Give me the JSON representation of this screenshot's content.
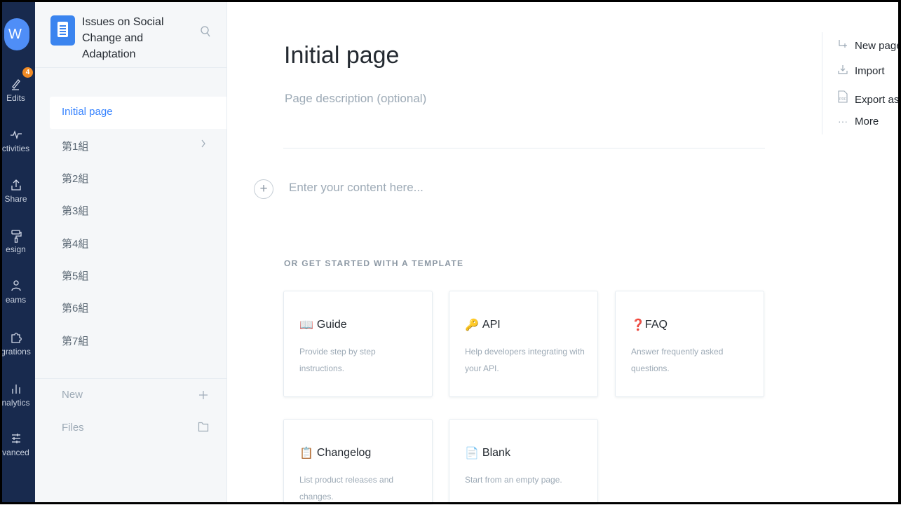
{
  "rail": {
    "avatar": "W",
    "badge": "4",
    "items": [
      {
        "icon": "edit-icon",
        "label": "Edits"
      },
      {
        "icon": "activity-icon",
        "label": "ctivities"
      },
      {
        "icon": "share-icon",
        "label": "Share"
      },
      {
        "icon": "paint-roller-icon",
        "label": "esign"
      },
      {
        "icon": "teams-icon",
        "label": "eams"
      },
      {
        "icon": "puzzle-icon",
        "label": "grations"
      },
      {
        "icon": "analytics-icon",
        "label": "nalytics"
      },
      {
        "icon": "sliders-icon",
        "label": "vanced"
      }
    ]
  },
  "sidebar": {
    "space_title": "Issues on Social Change and Adaptation",
    "pages": [
      {
        "label": "Initial page",
        "active": true
      },
      {
        "label": "第1組",
        "has_children": true
      },
      {
        "label": "第2組"
      },
      {
        "label": "第3組"
      },
      {
        "label": "第4組"
      },
      {
        "label": "第5組"
      },
      {
        "label": "第6組"
      },
      {
        "label": "第7組"
      }
    ],
    "new_label": "New",
    "files_label": "Files"
  },
  "main": {
    "title": "Initial page",
    "description_placeholder": "Page description (optional)",
    "content_placeholder": "Enter your content here...",
    "template_heading": "OR GET STARTED WITH A TEMPLATE",
    "templates": [
      {
        "emoji": "📖",
        "title": "Guide",
        "description": "Provide step by step instructions."
      },
      {
        "emoji": "🔑",
        "title": "API",
        "description": "Help developers integrating with your API."
      },
      {
        "emoji": "❓",
        "title": "FAQ",
        "description": "Answer frequently asked questions."
      },
      {
        "emoji": "📋",
        "title": "Changelog",
        "description": "List product releases and changes."
      },
      {
        "emoji": "📄",
        "title": "Blank",
        "description": "Start from an empty page."
      }
    ]
  },
  "actions": {
    "new_page": "New page",
    "import": "Import",
    "export": "Export as P",
    "more": "More"
  },
  "colors": {
    "rail": "#182a4e",
    "accent": "#3884ff",
    "badge": "#f08a24",
    "sidebar_bg": "#f5f7f9"
  }
}
